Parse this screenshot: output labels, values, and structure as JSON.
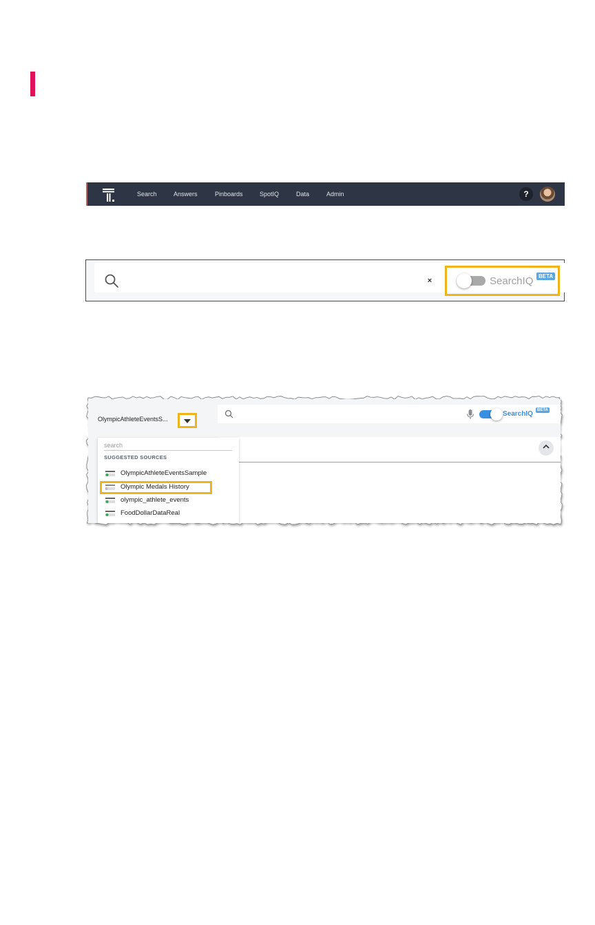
{
  "navbar": {
    "logo": "thoughtspot-logo-icon",
    "items": [
      {
        "label": "Search"
      },
      {
        "label": "Answers"
      },
      {
        "label": "Pinboards"
      },
      {
        "label": "SpotIQ"
      },
      {
        "label": "Data"
      },
      {
        "label": "Admin"
      }
    ],
    "help_label": "?",
    "avatar": "user-avatar"
  },
  "searchbar": {
    "clear_label": "×",
    "toggle_label": "SearchIQ",
    "toggle_state": "off",
    "beta_label": "BETA",
    "highlight_color": "#f0b41b"
  },
  "source_panel": {
    "selected_source": "OlympicAthleteEventsS...",
    "search_toggle_label": "SearchIQ",
    "search_toggle_state": "on",
    "beta_label": "BETA",
    "dropdown": {
      "search_placeholder": "search",
      "heading": "SUGGESTED SOURCES",
      "items": [
        {
          "label": "OlympicAthleteEventsSample"
        },
        {
          "label": "Olympic Medals History"
        },
        {
          "label": "olympic_athlete_events"
        },
        {
          "label": "FoodDollarDataReal"
        }
      ],
      "highlighted_item": "Olympic Medals History"
    }
  },
  "colors": {
    "navbar_bg": "#2e3544",
    "accent_blue": "#3b8fe0",
    "marker": "#e0105a",
    "highlight": "#f0b41b"
  }
}
